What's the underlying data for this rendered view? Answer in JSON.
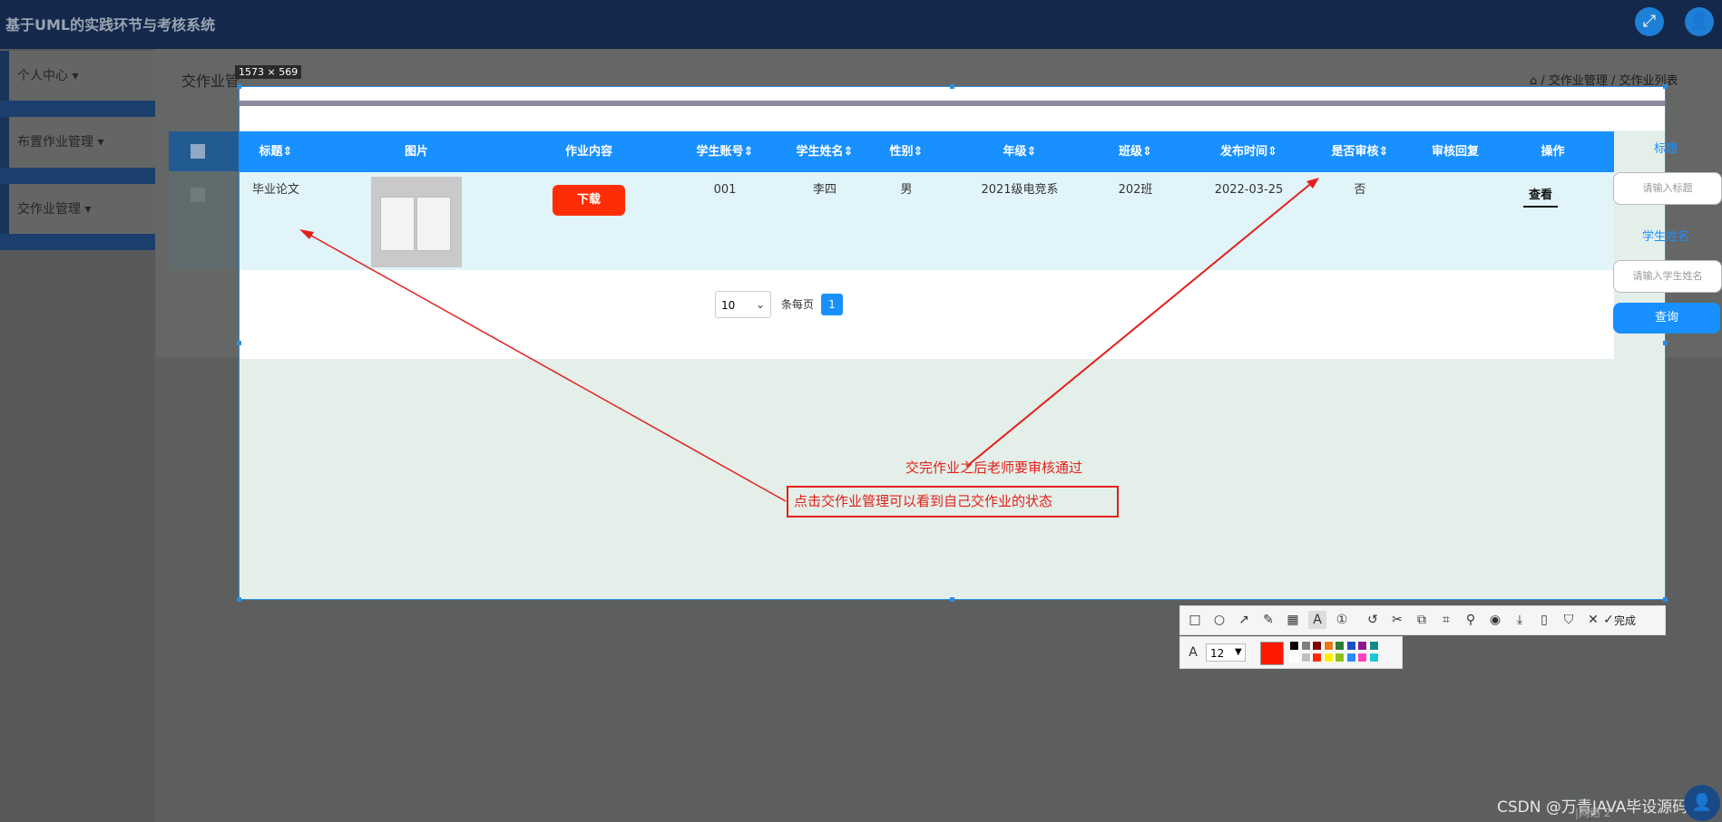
{
  "app": {
    "title": "基于UML的实践环节与考核系统"
  },
  "sidebar": {
    "items": [
      {
        "label": "个人中心 ▾"
      },
      {
        "label": "布置作业管理 ▾"
      },
      {
        "label": "交作业管理 ▾"
      }
    ]
  },
  "main": {
    "page_title": "交作业管",
    "breadcrumb": "⌂ / 交作业管理 / 交作业列表"
  },
  "capture": {
    "size_label": "1573 × 569"
  },
  "table": {
    "columns": [
      "标题⇕",
      "图片",
      "作业内容",
      "学生账号⇕",
      "学生姓名⇕",
      "性别⇕",
      "年级⇕",
      "班级⇕",
      "发布时间⇕",
      "是否审核⇕",
      "审核回复",
      "操作"
    ],
    "row": {
      "title": "毕业论文",
      "download": "下载",
      "account": "001",
      "name": "李四",
      "gender": "男",
      "grade": "2021级电竞系",
      "class": "202班",
      "date": "2022-03-25",
      "reviewed": "否",
      "reply": "",
      "action": "查看"
    }
  },
  "pager": {
    "page_size": "10",
    "per_page_label": "条每页",
    "current_page": "1"
  },
  "search": {
    "title_label": "标题",
    "title_placeholder": "请输入标题",
    "name_label": "学生姓名",
    "name_placeholder": "请输入学生姓名",
    "query_button": "查询"
  },
  "annotations": {
    "note1": "交完作业之后老师要审核通过",
    "note2": "点击交作业管理可以看到自己交作业的状态"
  },
  "toolbar": {
    "done_label": "完成",
    "font_size": "12",
    "current_color": "#ff1800"
  },
  "swatches": [
    "#000000",
    "#808080",
    "#800000",
    "#e87a1a",
    "#2e7d32",
    "#1e4fc4",
    "#8b1a8b",
    "#138a8a",
    "#ffffff",
    "#c0c0c0",
    "#ff2a00",
    "#ffee00",
    "#8fbf1a",
    "#2a8cff",
    "#ff40c0",
    "#1ac8d8"
  ],
  "footer": {
    "watermark": "CSDN @万青JAVA毕设源码",
    "pager": "|网络 2"
  }
}
